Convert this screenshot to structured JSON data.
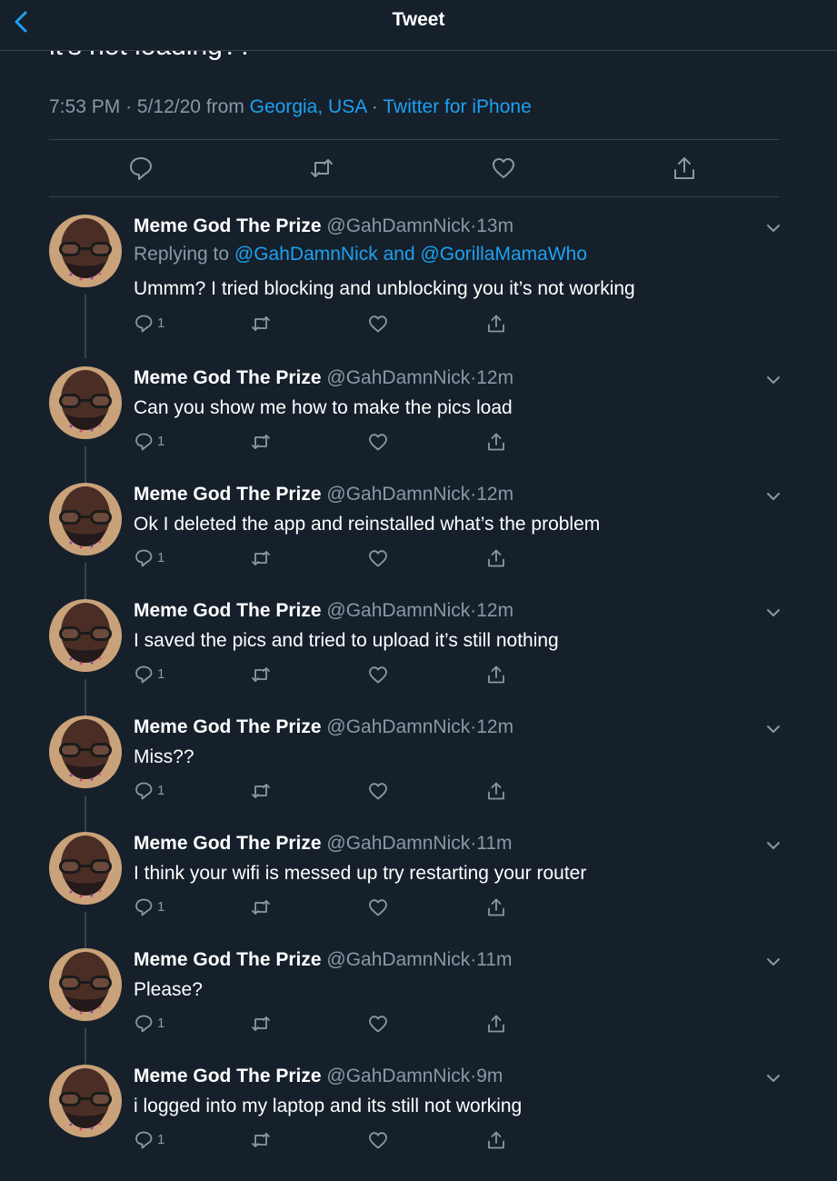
{
  "header": {
    "title": "Tweet"
  },
  "main_tweet": {
    "text_cut": "it's not loading??",
    "time": "7:53 PM",
    "date": "5/12/20",
    "from_label": "from",
    "location": "Georgia, USA",
    "source": "Twitter for iPhone"
  },
  "colors": {
    "background": "#15202b",
    "link": "#1da1f2",
    "muted": "#8899a6",
    "border": "#38444d"
  },
  "replies": [
    {
      "name": "Meme God The Prize",
      "handle": "@GahDamnNick",
      "time": "13m",
      "replying_prefix": "Replying to",
      "replying_to": "@GahDamnNick and @GorillaMamaWho",
      "text": "Ummm? I tried blocking and unblocking you it’s not working",
      "reply_count": "1"
    },
    {
      "name": "Meme God The Prize",
      "handle": "@GahDamnNick",
      "time": "12m",
      "text": "Can you show me how to make the pics load",
      "reply_count": "1"
    },
    {
      "name": "Meme God The Prize",
      "handle": "@GahDamnNick",
      "time": "12m",
      "text": "Ok I deleted the app and reinstalled what’s the problem",
      "reply_count": "1"
    },
    {
      "name": "Meme God The Prize",
      "handle": "@GahDamnNick",
      "time": "12m",
      "text": "I saved the pics and tried to upload it’s still nothing",
      "reply_count": "1"
    },
    {
      "name": "Meme God The Prize",
      "handle": "@GahDamnNick",
      "time": "12m",
      "text": "Miss??",
      "reply_count": "1"
    },
    {
      "name": "Meme God The Prize",
      "handle": "@GahDamnNick",
      "time": "11m",
      "text": "I think your wifi is messed up try restarting your router",
      "reply_count": "1"
    },
    {
      "name": "Meme God The Prize",
      "handle": "@GahDamnNick",
      "time": "11m",
      "text": "Please?",
      "reply_count": "1"
    },
    {
      "name": "Meme God The Prize",
      "handle": "@GahDamnNick",
      "time": "9m",
      "text": "i logged into my laptop and its still not working",
      "reply_count": "1"
    }
  ]
}
